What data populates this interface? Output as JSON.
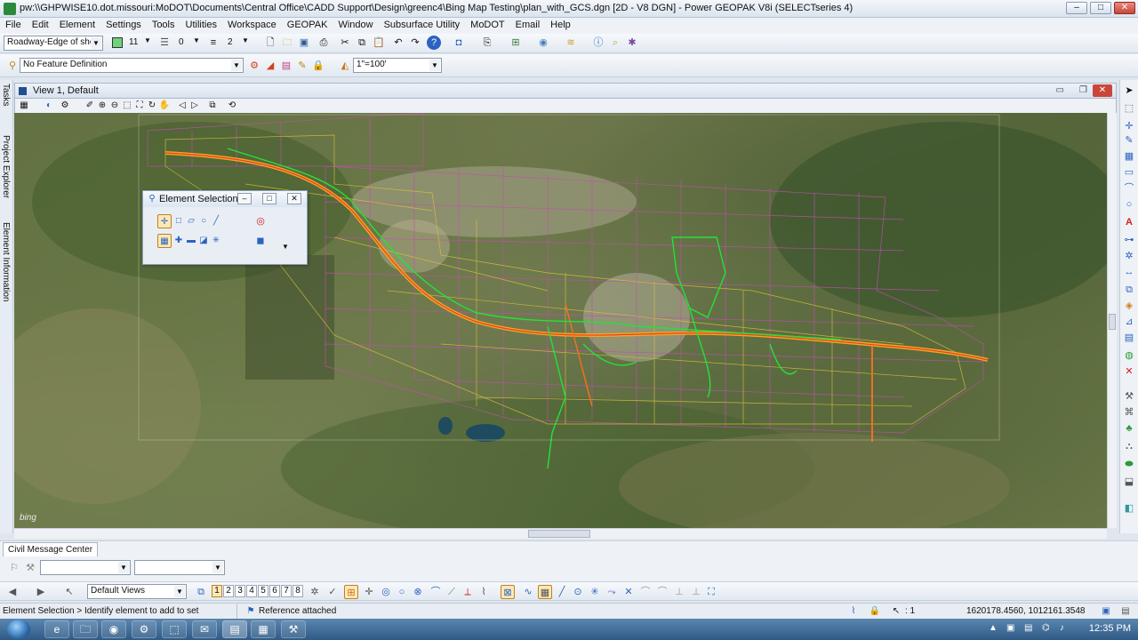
{
  "window": {
    "title": "pw:\\\\GHPWISE10.dot.missouri:MoDOT\\Documents\\Central Office\\CADD Support\\Design\\greenc4\\Bing Map Testing\\plan_with_GCS.dgn [2D - V8 DGN] - Power GEOPAK V8i (SELECTseries 4)",
    "buttons": {
      "minimize": "–",
      "maximize": "□",
      "close": "✕"
    }
  },
  "menu": [
    "File",
    "Edit",
    "Element",
    "Settings",
    "Tools",
    "Utilities",
    "Workspace",
    "GEOPAK",
    "Window",
    "Subsurface Utility",
    "MoDOT",
    "Email",
    "Help"
  ],
  "attributes_toolbar": {
    "level": "Roadway-Edge of shou",
    "color": "11",
    "style": "0",
    "weight": "2"
  },
  "feature_toolbar": {
    "feature_definition": "No Feature Definition",
    "scale": "1\"=100'"
  },
  "view": {
    "title": "View 1, Default",
    "watermark": "bing"
  },
  "left_tabs": [
    "Tasks",
    "Project Explorer",
    "Element Information"
  ],
  "element_selection": {
    "title": "Element Selection"
  },
  "message_center": {
    "tab": "Civil Message Center"
  },
  "view_groups": {
    "selected": "Default Views",
    "views": [
      "1",
      "2",
      "3",
      "4",
      "5",
      "6",
      "7",
      "8"
    ]
  },
  "status": {
    "prompt": "Element Selection > Identify element to add to set",
    "message": "Reference attached",
    "selection_count": ": 1",
    "coordinates": "1620178.4560, 1012161.3548"
  },
  "taskbar": {
    "clock": "12:35 PM"
  },
  "colors": {
    "alignment": "#f5a623",
    "grid_yellow": "#d9c23a",
    "grid_magenta": "#c24fb0",
    "survey_green": "#22e33a"
  }
}
